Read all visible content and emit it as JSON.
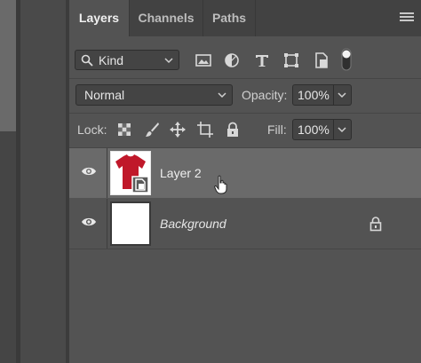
{
  "tabs": [
    {
      "label": "Layers",
      "active": true
    },
    {
      "label": "Channels",
      "active": false
    },
    {
      "label": "Paths",
      "active": false
    }
  ],
  "filter": {
    "kind_label": "Kind",
    "icons": [
      "image-filter-icon",
      "adjustment-filter-icon",
      "type-filter-icon",
      "shape-filter-icon",
      "smart-object-filter-icon"
    ]
  },
  "blend": {
    "mode": "Normal",
    "opacity_label": "Opacity:",
    "opacity_value": "100%"
  },
  "lock": {
    "label": "Lock:",
    "fill_label": "Fill:",
    "fill_value": "100%"
  },
  "layers": [
    {
      "name": "Layer 2",
      "selected": true,
      "visible": true,
      "locked": false,
      "type": "smart-object"
    },
    {
      "name": "Background",
      "selected": false,
      "visible": true,
      "locked": true,
      "type": "background"
    }
  ],
  "colors": {
    "panel_bg": "#535353",
    "selected_row": "#6a6a6a",
    "shirt_red": "#c0182a"
  }
}
